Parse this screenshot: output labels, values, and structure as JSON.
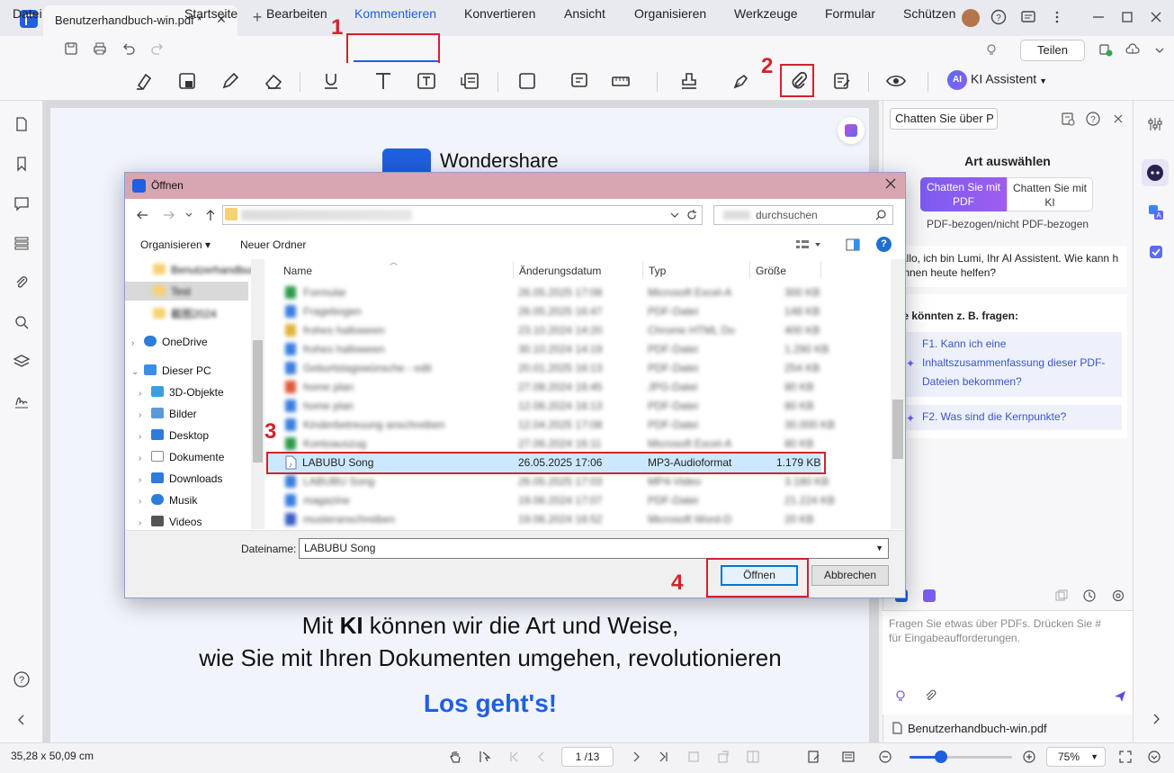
{
  "window": {
    "tab_title": "Benutzerhandbuch-win.pdf *",
    "tab_close": "✕",
    "new_tab": "+"
  },
  "menu": {
    "file": "Datei",
    "items": [
      "Startseite",
      "Bearbeiten",
      "Kommentieren",
      "Konvertieren",
      "Ansicht",
      "Organisieren",
      "Werkzeuge",
      "Formular",
      "Schützen"
    ],
    "share": "Teilen"
  },
  "toolbar": {
    "ai_badge": "AI",
    "ai_assistant": "KI Assistent"
  },
  "annotations": [
    "1",
    "2",
    "3",
    "4"
  ],
  "document": {
    "brand": "Wondershare",
    "line1_pre": "Mit ",
    "line1_bold": "KI",
    "line1_post": " können wir die Art und Weise,",
    "line2": "wie Sie mit Ihren Dokumenten umgehen, revolutionieren",
    "cta": "Los geht's!"
  },
  "ai_panel": {
    "dropdown": "Chatten Sie über P",
    "title": "Art auswählen",
    "segment_pdf": "Chatten Sie mit PDF",
    "segment_ai": "Chatten Sie mit KI",
    "subtitle": "PDF-bezogen/nicht PDF-bezogen",
    "greeting": "allo, ich bin Lumi, Ihr AI Assistent. Wie kann h Ihnen heute helfen?",
    "suggest_title": "ie könnten z. B. fragen:",
    "questions": [
      "F1. Kann ich eine Inhaltszusammenfassung dieser PDF-Dateien bekommen?",
      "F2. Was sind die Kernpunkte?"
    ],
    "input_hint": "Fragen Sie etwas über PDFs. Drücken Sie # für Eingabeaufforderungen.",
    "file": "Benutzerhandbuch-win.pdf"
  },
  "statusbar": {
    "dimensions": "35,28 x 50,09 cm",
    "page": "1 /13",
    "zoom": "75%",
    "zoom_level": 0.31
  },
  "dialog": {
    "title": "Öffnen",
    "search_placeholder": "durchsuchen",
    "organize": "Organisieren ▾",
    "new_folder": "Neuer Ordner",
    "help": "?",
    "nav": [
      {
        "label": "OneDrive",
        "icon": "cloud-icon",
        "color": "#2f7bd8"
      },
      {
        "label": "Dieser PC",
        "icon": "computer-icon",
        "color": "#3a8ee6"
      },
      {
        "label": "3D-Objekte",
        "icon": "cube-icon",
        "color": "#39a0e0"
      },
      {
        "label": "Bilder",
        "icon": "pictures-icon",
        "color": "#5b9bd5"
      },
      {
        "label": "Desktop",
        "icon": "desktop-icon",
        "color": "#2f7bd8"
      },
      {
        "label": "Dokumente",
        "icon": "documents-icon",
        "color": "#8a8a8a"
      },
      {
        "label": "Downloads",
        "icon": "download-icon",
        "color": "#2f7bd8"
      },
      {
        "label": "Musik",
        "icon": "music-icon",
        "color": "#2f7bd8"
      },
      {
        "label": "Videos",
        "icon": "video-icon",
        "color": "#555555"
      }
    ],
    "columns": [
      "Name",
      "Änderungsdatum",
      "Typ",
      "Größe"
    ],
    "selected_file": {
      "name": "LABUBU Song",
      "date": "26.05.2025 17:06",
      "type": "MP3-Audioformat",
      "size": "1.179 KB"
    },
    "filename_label": "Dateiname:",
    "filename_value": "LABUBU Song",
    "open_button": "Öffnen",
    "cancel_button": "Abbrechen"
  }
}
